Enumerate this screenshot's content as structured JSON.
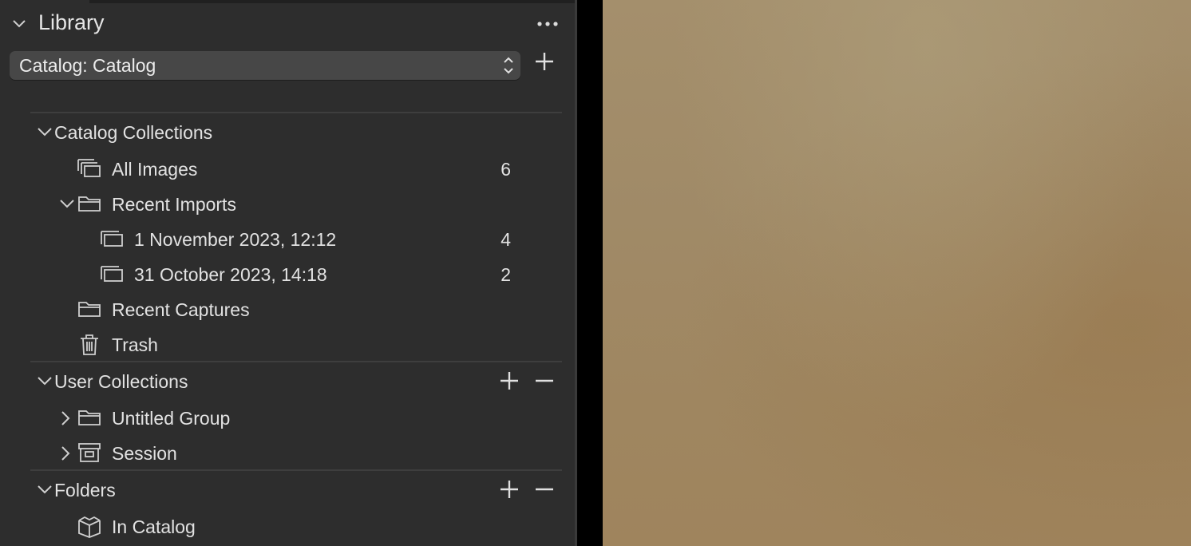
{
  "library": {
    "title": "Library",
    "catalog_select": "Catalog: Catalog"
  },
  "sections": {
    "catalog_collections": {
      "title": "Catalog Collections",
      "items": [
        {
          "label": "All Images",
          "count": "6",
          "icon": "all-images-icon"
        },
        {
          "label": "Recent Imports",
          "count": "",
          "icon": "folder-icon"
        },
        {
          "label": "1 November 2023, 12:12",
          "count": "4",
          "icon": "album-icon"
        },
        {
          "label": "31 October 2023, 14:18",
          "count": "2",
          "icon": "album-icon"
        },
        {
          "label": "Recent Captures",
          "count": "",
          "icon": "folder-icon"
        },
        {
          "label": "Trash",
          "count": "",
          "icon": "trash-icon"
        }
      ]
    },
    "user_collections": {
      "title": "User Collections",
      "items": [
        {
          "label": "Untitled Group",
          "icon": "folder-icon"
        },
        {
          "label": "Session",
          "icon": "session-icon"
        }
      ]
    },
    "folders": {
      "title": "Folders",
      "items": [
        {
          "label": "In Catalog",
          "icon": "catalog-box-icon"
        }
      ]
    }
  },
  "colors": {
    "panel_bg": "#2d2d2d",
    "select_bg": "#474747",
    "text": "#e2e2e2",
    "viewer_bg": "#a08a67"
  }
}
